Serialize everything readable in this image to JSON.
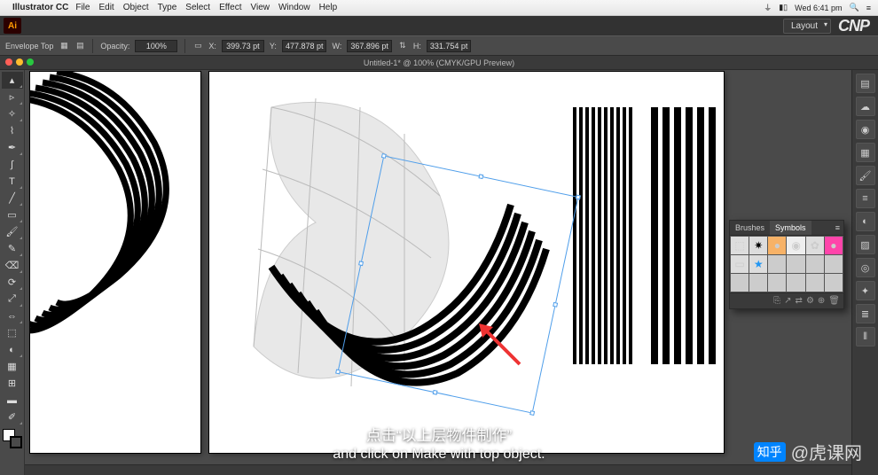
{
  "mac": {
    "app": "Illustrator CC",
    "menus": [
      "File",
      "Edit",
      "Object",
      "Type",
      "Select",
      "Effect",
      "View",
      "Window",
      "Help"
    ],
    "clock": "Wed 6:41 pm"
  },
  "chrome": {
    "ai": "Ai",
    "layout_label": "Layout",
    "brand": "CNP"
  },
  "options": {
    "label": "Envelope Top",
    "edit_btn": "☰",
    "opacity_label": "Opacity:",
    "opacity_value": "100%",
    "x_icon": "X:",
    "x_value": "399.73 pt",
    "y_icon": "Y:",
    "y_value": "477.878 pt",
    "w_icon": "W:",
    "w_value": "367.896 pt",
    "h_icon": "H:",
    "h_value": "331.754 pt"
  },
  "doc": {
    "title": "Untitled-1* @ 100% (CMYK/GPU Preview)"
  },
  "symbols": {
    "tab_brushes": "Brushes",
    "tab_symbols": "Symbols"
  },
  "subtitle": {
    "cn": "点击“以上层物件制作”",
    "en": "and click on Make with top object."
  },
  "watermark": {
    "logo": "知乎",
    "text": "@虎课网"
  }
}
